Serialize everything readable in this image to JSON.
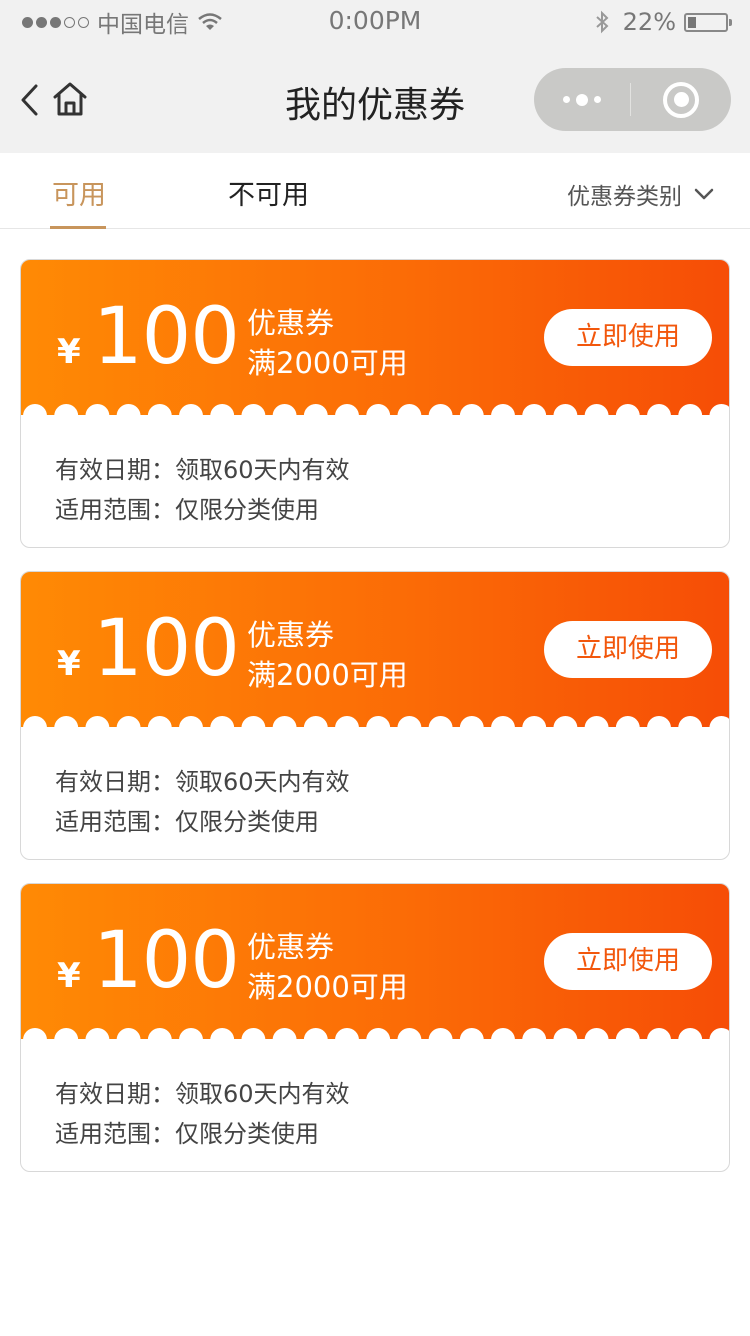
{
  "status_bar": {
    "carrier": "中国电信",
    "time": "0:00PM",
    "battery_percent": "22%",
    "battery_level": 0.22,
    "signal_strength": 3,
    "signal_max": 5
  },
  "nav": {
    "title": "我的优惠券"
  },
  "tabs": [
    {
      "label": "可用",
      "active": true
    },
    {
      "label": "不可用",
      "active": false
    }
  ],
  "filter": {
    "label": "优惠券类别"
  },
  "coupons": [
    {
      "currency": "¥",
      "amount": "100",
      "type": "优惠券",
      "condition": "满2000可用",
      "button": "立即使用",
      "validity": "有效日期：领取60天内有效",
      "scope": "适用范围：仅限分类使用"
    },
    {
      "currency": "¥",
      "amount": "100",
      "type": "优惠券",
      "condition": "满2000可用",
      "button": "立即使用",
      "validity": "有效日期：领取60天内有效",
      "scope": "适用范围：仅限分类使用"
    },
    {
      "currency": "¥",
      "amount": "100",
      "type": "优惠券",
      "condition": "满2000可用",
      "button": "立即使用",
      "validity": "有效日期：领取60天内有效",
      "scope": "适用范围：仅限分类使用"
    }
  ],
  "colors": {
    "accent": "#c8955c",
    "coupon_gradient_start": "#ff8a05",
    "coupon_gradient_end": "#f64d06",
    "button_text": "#f2570c",
    "nav_background": "#f1f1f1"
  }
}
